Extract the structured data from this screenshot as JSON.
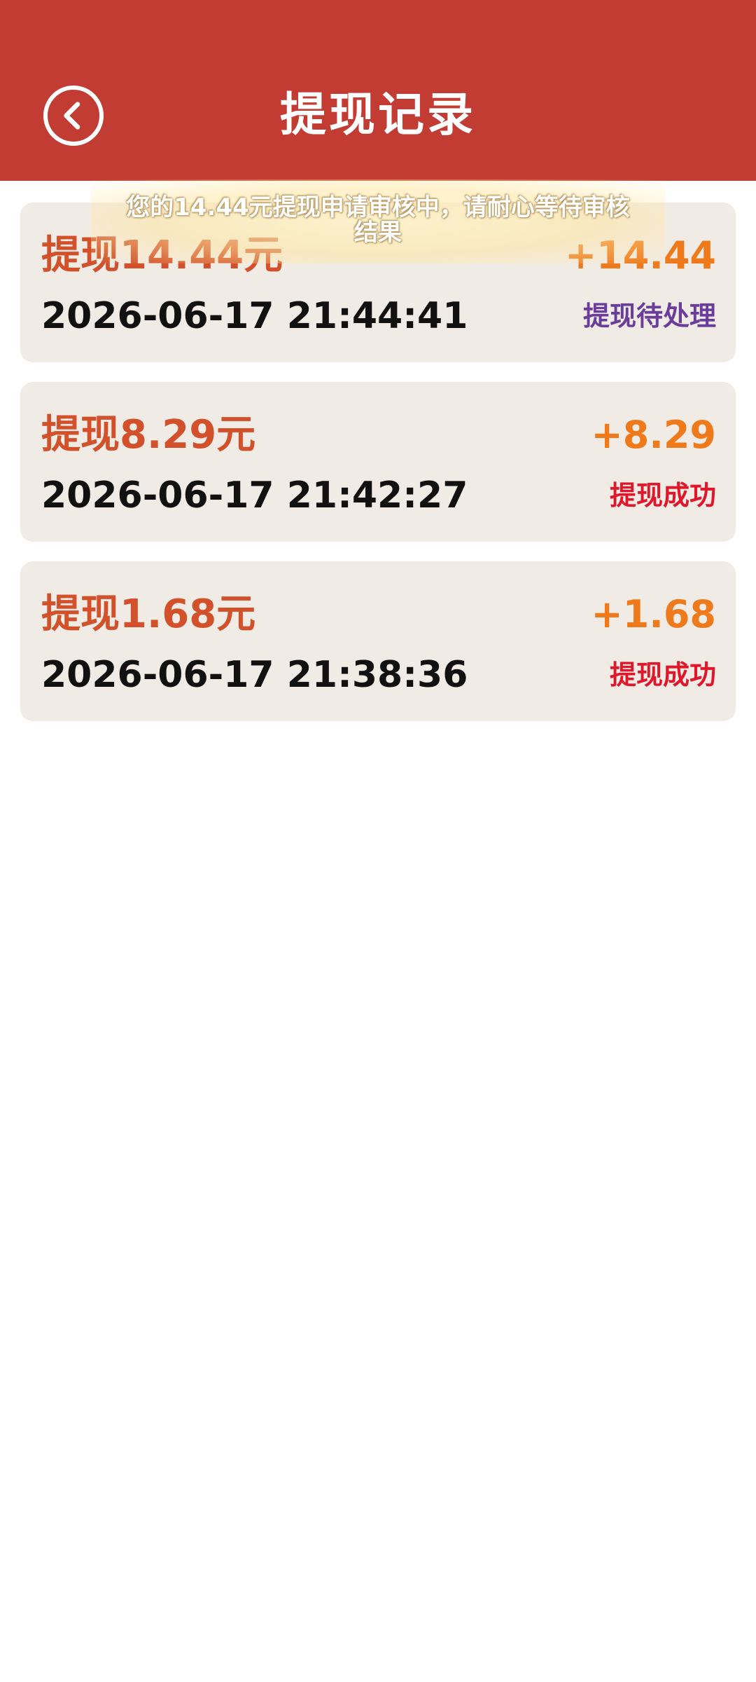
{
  "header": {
    "title": "提现记录",
    "background_color": "#c23c33",
    "back_icon": "chevron-left-circle-icon"
  },
  "records": [
    {
      "amount_label": "提现14.44元",
      "amount_value": "+14.44",
      "datetime": "2026-06-17 21:44:41",
      "status": "提现待处理",
      "status_color": "#6a3d9a"
    },
    {
      "amount_label": "提现8.29元",
      "amount_value": "+8.29",
      "datetime": "2026-06-17 21:42:27",
      "status": "提现成功",
      "status_color": "#e0162b"
    },
    {
      "amount_label": "提现1.68元",
      "amount_value": "+1.68",
      "datetime": "2026-06-17 21:38:36",
      "status": "提现成功",
      "status_color": "#e0162b"
    }
  ],
  "toast": {
    "line1": "您的14.44元提现申请审核中，请耐心等待审核",
    "line2": "结果"
  },
  "colors": {
    "amount_label": "#d2502a",
    "amount_value": "#ef7a1c",
    "card_background": "#f1ebe5"
  }
}
